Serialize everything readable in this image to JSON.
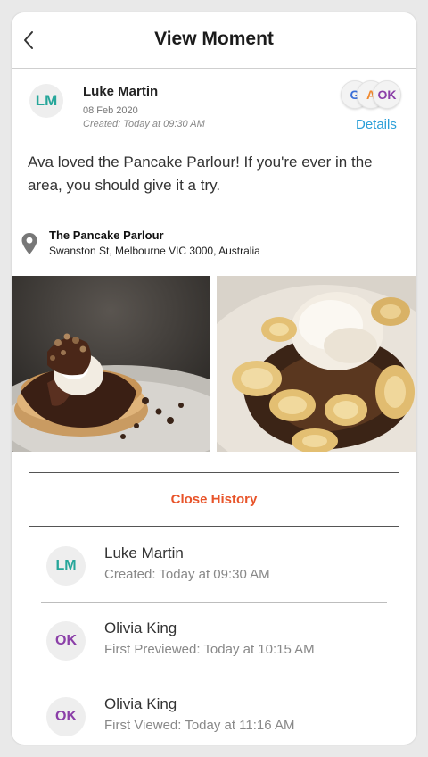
{
  "header": {
    "title": "View Moment"
  },
  "post": {
    "author_initials": "LM",
    "author_name": "Luke Martin",
    "date": "08 Feb 2020",
    "created": "Created: Today at 09:30 AM",
    "text": "Ava loved the Pancake Parlour! If you're ever in the area, you should give it a try.",
    "audience": [
      {
        "label": "G",
        "color": "#3b6fd8"
      },
      {
        "label": "A",
        "color": "#f0892e"
      },
      {
        "label": "OK",
        "color": "#8b3fa8"
      }
    ],
    "details_label": "Details"
  },
  "location": {
    "name": "The Pancake Parlour",
    "address": "Swanston St, Melbourne VIC 3000, Australia"
  },
  "history": {
    "toggle_label": "Close History",
    "entries": [
      {
        "initials": "LM",
        "initials_color": "#26a69a",
        "name": "Luke Martin",
        "action": "Created: Today at 09:30 AM"
      },
      {
        "initials": "OK",
        "initials_color": "#8b3fa8",
        "name": "Olivia King",
        "action": "First Previewed: Today at 10:15 AM"
      },
      {
        "initials": "OK",
        "initials_color": "#8b3fa8",
        "name": "Olivia King",
        "action": "First Viewed: Today at 11:16 AM"
      }
    ]
  },
  "colors": {
    "accent_link": "#2a9fd8",
    "history_toggle": "#e8542a"
  }
}
